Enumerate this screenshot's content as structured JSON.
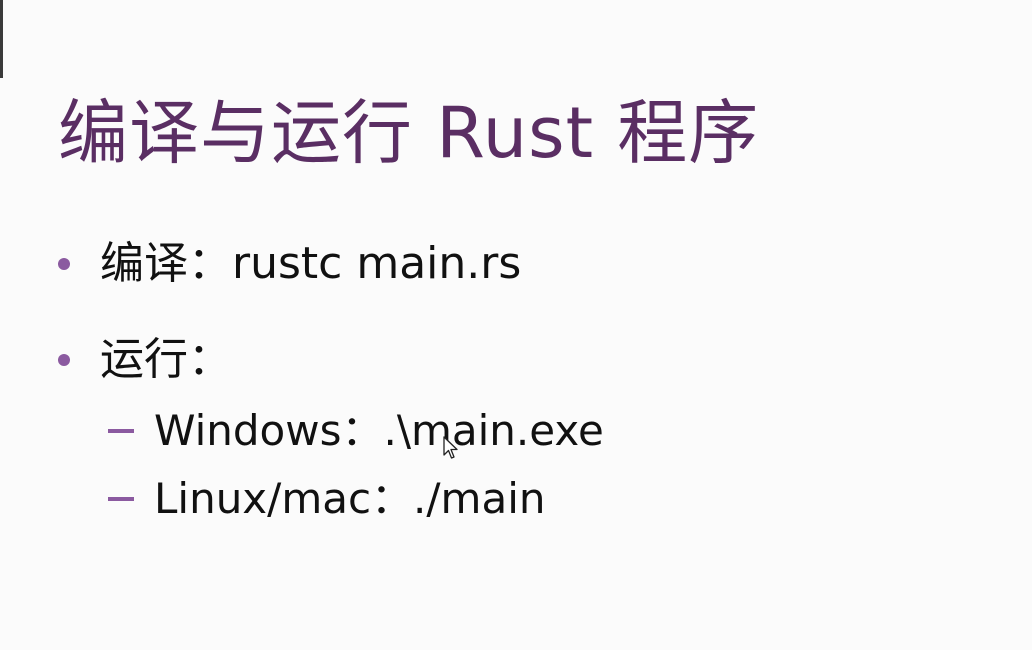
{
  "slide": {
    "title": "编译与运行 Rust 程序",
    "bullets": [
      {
        "text": "编译：rustc main.rs"
      },
      {
        "text": "运行：",
        "subitems": [
          {
            "text": "Windows：.\\main.exe"
          },
          {
            "text": "Linux/mac：./main"
          }
        ]
      }
    ]
  },
  "colors": {
    "title": "#5a2e63",
    "bullet_marker": "#8b5aa0",
    "body_text": "#111111",
    "background": "#fbfbfb"
  },
  "icons": {
    "cursor": "mouse-pointer-icon"
  }
}
